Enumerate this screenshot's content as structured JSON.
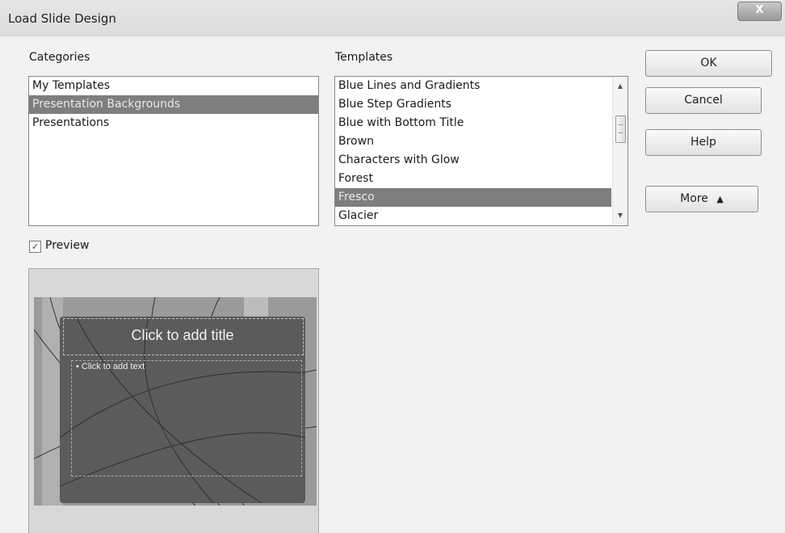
{
  "window": {
    "title": "Load Slide Design",
    "close_label": "X"
  },
  "categories": {
    "label": "Categories",
    "items": [
      {
        "label": "My Templates",
        "selected": false
      },
      {
        "label": "Presentation Backgrounds",
        "selected": true
      },
      {
        "label": "Presentations",
        "selected": false
      }
    ]
  },
  "templates": {
    "label": "Templates",
    "items": [
      {
        "label": "Blue Lines and Gradients",
        "selected": false
      },
      {
        "label": "Blue Step Gradients",
        "selected": false
      },
      {
        "label": "Blue with Bottom Title",
        "selected": false
      },
      {
        "label": "Brown",
        "selected": false
      },
      {
        "label": "Characters with Glow",
        "selected": false
      },
      {
        "label": "Forest",
        "selected": false
      },
      {
        "label": "Fresco",
        "selected": true
      },
      {
        "label": "Glacier",
        "selected": false
      }
    ]
  },
  "buttons": {
    "ok": "OK",
    "cancel": "Cancel",
    "help": "Help",
    "more": "More",
    "more_icon": "▲"
  },
  "preview": {
    "label": "Preview",
    "checked": true,
    "check_mark": "✓",
    "slide_title": "Click to add title",
    "slide_body": "• Click to add text"
  },
  "scroll": {
    "up": "▲",
    "down": "▼"
  }
}
